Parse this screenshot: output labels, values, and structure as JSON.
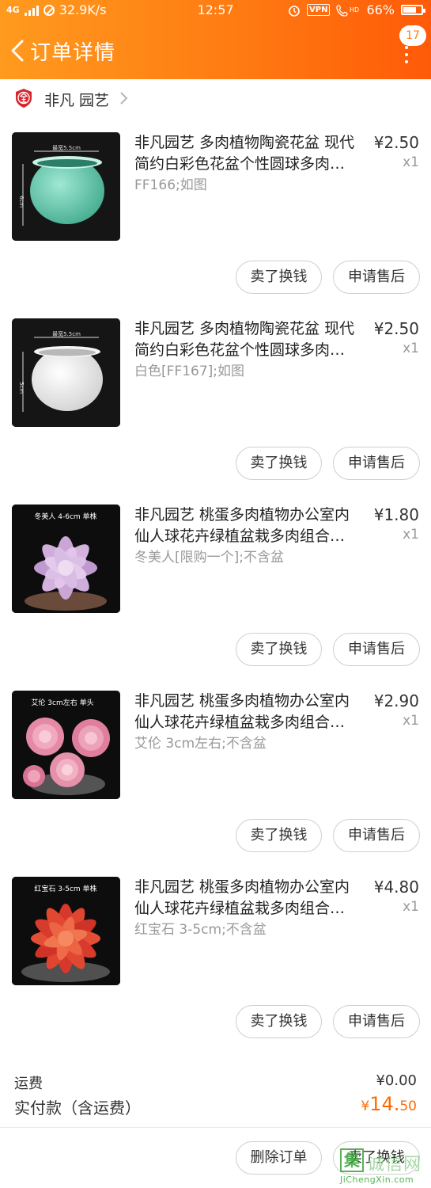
{
  "status_bar": {
    "network": "4G",
    "speed": "32.9K/s",
    "time": "12:57",
    "vpn": "VPN",
    "hd": "HD",
    "battery": "66%"
  },
  "header": {
    "title": "订单详情",
    "badge_count": "17"
  },
  "shop": {
    "name": "非凡 园艺"
  },
  "items": [
    {
      "title": "非凡园艺 多肉植物陶瓷花盆 现代简约白彩色花盆个性圆球多肉…",
      "price": "¥2.50",
      "qty": "x1",
      "spec": "FF166;如图",
      "thumb_label": "最宽5.5cm",
      "thumb_side": "6cm",
      "btn_sell": "卖了换钱",
      "btn_after": "申请售后"
    },
    {
      "title": "非凡园艺 多肉植物陶瓷花盆 现代简约白彩色花盆个性圆球多肉…",
      "price": "¥2.50",
      "qty": "x1",
      "spec": "白色[FF167];如图",
      "thumb_label": "最宽5.5cm",
      "thumb_side": "5cm",
      "btn_sell": "卖了换钱",
      "btn_after": "申请售后"
    },
    {
      "title": "非凡园艺 桃蛋多肉植物办公室内仙人球花卉绿植盆栽多肉组合…",
      "price": "¥1.80",
      "qty": "x1",
      "spec": "冬美人[限购一个];不含盆",
      "thumb_label": "冬美人 4-6cm 单株",
      "btn_sell": "卖了换钱",
      "btn_after": "申请售后"
    },
    {
      "title": "非凡园艺 桃蛋多肉植物办公室内仙人球花卉绿植盆栽多肉组合…",
      "price": "¥2.90",
      "qty": "x1",
      "spec": "艾伦 3cm左右;不含盆",
      "thumb_label": "艾伦 3cm左右 单头",
      "btn_sell": "卖了换钱",
      "btn_after": "申请售后"
    },
    {
      "title": "非凡园艺 桃蛋多肉植物办公室内仙人球花卉绿植盆栽多肉组合…",
      "price": "¥4.80",
      "qty": "x1",
      "spec": "红宝石 3-5cm;不含盆",
      "thumb_label": "红宝石 3-5cm 单株",
      "btn_sell": "卖了换钱",
      "btn_after": "申请售后"
    }
  ],
  "totals": {
    "shipping_label": "运费",
    "shipping_value": "¥0.00",
    "paid_label": "实付款（含运费）",
    "paid_currency": "¥",
    "paid_int": "14.",
    "paid_dec": "50"
  },
  "bottom": {
    "delete": "删除订单",
    "sell": "卖了换钱"
  },
  "watermark": {
    "char": "集",
    "text": "诚信网",
    "url": "JiChengXin.com"
  },
  "colors": {
    "header_start": "#ff9a1e",
    "header_end": "#ff5a08",
    "price_accent": "#ff6a00"
  }
}
